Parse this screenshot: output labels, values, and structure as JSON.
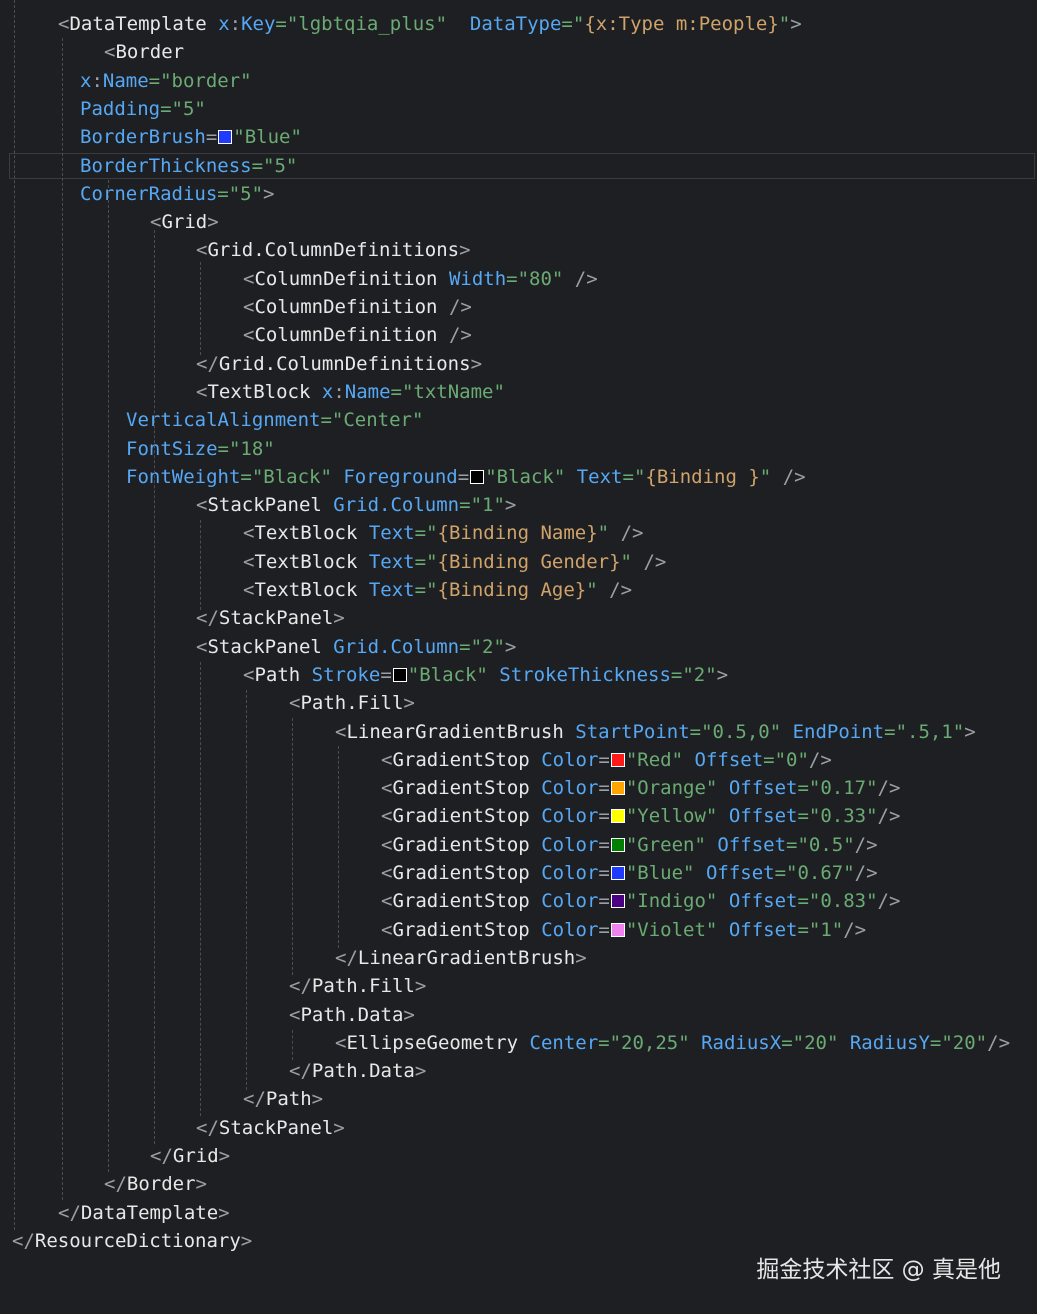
{
  "editor": {
    "lines": [
      {
        "indent": 58,
        "tokens": [
          [
            "b",
            "<"
          ],
          [
            "e",
            "DataTemplate"
          ],
          [
            "s",
            " "
          ],
          [
            "a",
            "x"
          ],
          [
            "b",
            ":"
          ],
          [
            "a",
            "Key"
          ],
          [
            "q",
            "=\"lgbtqia_plus\""
          ],
          [
            "s",
            "  "
          ],
          [
            "a",
            "DataType"
          ],
          [
            "q",
            "=\""
          ],
          [
            "x",
            "{x:Type m:People}"
          ],
          [
            "q",
            "\""
          ],
          [
            "b",
            ">"
          ]
        ]
      },
      {
        "indent": 104,
        "tokens": [
          [
            "b",
            "<"
          ],
          [
            "e",
            "Border"
          ]
        ]
      },
      {
        "indent": 80,
        "tokens": [
          [
            "a",
            "x"
          ],
          [
            "b",
            ":"
          ],
          [
            "a",
            "Name"
          ],
          [
            "q",
            "=\"border\""
          ]
        ]
      },
      {
        "indent": 80,
        "tokens": [
          [
            "a",
            "Padding"
          ],
          [
            "q",
            "=\"5\""
          ]
        ]
      },
      {
        "indent": 80,
        "tokens": [
          [
            "a",
            "BorderBrush"
          ],
          [
            "b",
            "="
          ],
          [
            "sw",
            "#1f3bff"
          ],
          [
            "q",
            "\"Blue\""
          ]
        ]
      },
      {
        "indent": 80,
        "tokens": [
          [
            "a",
            "BorderThickness"
          ],
          [
            "q",
            "=\"5\""
          ]
        ],
        "current": true
      },
      {
        "indent": 80,
        "tokens": [
          [
            "a",
            "CornerRadius"
          ],
          [
            "q",
            "=\"5\""
          ],
          [
            "b",
            ">"
          ]
        ]
      },
      {
        "indent": 150,
        "tokens": [
          [
            "b",
            "<"
          ],
          [
            "e",
            "Grid"
          ],
          [
            "b",
            ">"
          ]
        ]
      },
      {
        "indent": 196,
        "tokens": [
          [
            "b",
            "<"
          ],
          [
            "e",
            "Grid.ColumnDefinitions"
          ],
          [
            "b",
            ">"
          ]
        ]
      },
      {
        "indent": 243,
        "tokens": [
          [
            "b",
            "<"
          ],
          [
            "e",
            "ColumnDefinition"
          ],
          [
            "s",
            " "
          ],
          [
            "a",
            "Width"
          ],
          [
            "q",
            "=\"80\""
          ],
          [
            "s",
            " "
          ],
          [
            "b",
            "/>"
          ]
        ]
      },
      {
        "indent": 243,
        "tokens": [
          [
            "b",
            "<"
          ],
          [
            "e",
            "ColumnDefinition"
          ],
          [
            "s",
            " "
          ],
          [
            "b",
            "/>"
          ]
        ]
      },
      {
        "indent": 243,
        "tokens": [
          [
            "b",
            "<"
          ],
          [
            "e",
            "ColumnDefinition"
          ],
          [
            "s",
            " "
          ],
          [
            "b",
            "/>"
          ]
        ]
      },
      {
        "indent": 196,
        "tokens": [
          [
            "b",
            "</"
          ],
          [
            "e",
            "Grid.ColumnDefinitions"
          ],
          [
            "b",
            ">"
          ]
        ]
      },
      {
        "indent": 196,
        "tokens": [
          [
            "b",
            "<"
          ],
          [
            "e",
            "TextBlock"
          ],
          [
            "s",
            " "
          ],
          [
            "a",
            "x"
          ],
          [
            "b",
            ":"
          ],
          [
            "a",
            "Name"
          ],
          [
            "q",
            "=\"txtName\""
          ]
        ]
      },
      {
        "indent": 126,
        "tokens": [
          [
            "a",
            "VerticalAlignment"
          ],
          [
            "q",
            "=\"Center\""
          ]
        ]
      },
      {
        "indent": 126,
        "tokens": [
          [
            "a",
            "FontSize"
          ],
          [
            "q",
            "=\"18\""
          ]
        ]
      },
      {
        "indent": 126,
        "tokens": [
          [
            "a",
            "FontWeight"
          ],
          [
            "q",
            "=\"Black\""
          ],
          [
            "s",
            " "
          ],
          [
            "a",
            "Foreground"
          ],
          [
            "b",
            "="
          ],
          [
            "sw",
            "#000000"
          ],
          [
            "q",
            "\"Black\""
          ],
          [
            "s",
            " "
          ],
          [
            "a",
            "Text"
          ],
          [
            "q",
            "=\""
          ],
          [
            "x",
            "{Binding }"
          ],
          [
            "q",
            "\""
          ],
          [
            "s",
            " "
          ],
          [
            "b",
            "/>"
          ]
        ]
      },
      {
        "indent": 196,
        "tokens": [
          [
            "b",
            "<"
          ],
          [
            "e",
            "StackPanel"
          ],
          [
            "s",
            " "
          ],
          [
            "a",
            "Grid.Column"
          ],
          [
            "q",
            "=\"1\""
          ],
          [
            "b",
            ">"
          ]
        ]
      },
      {
        "indent": 243,
        "tokens": [
          [
            "b",
            "<"
          ],
          [
            "e",
            "TextBlock"
          ],
          [
            "s",
            " "
          ],
          [
            "a",
            "Text"
          ],
          [
            "q",
            "=\""
          ],
          [
            "x",
            "{Binding Name}"
          ],
          [
            "q",
            "\""
          ],
          [
            "s",
            " "
          ],
          [
            "b",
            "/>"
          ]
        ]
      },
      {
        "indent": 243,
        "tokens": [
          [
            "b",
            "<"
          ],
          [
            "e",
            "TextBlock"
          ],
          [
            "s",
            " "
          ],
          [
            "a",
            "Text"
          ],
          [
            "q",
            "=\""
          ],
          [
            "x",
            "{Binding Gender}"
          ],
          [
            "q",
            "\""
          ],
          [
            "s",
            " "
          ],
          [
            "b",
            "/>"
          ]
        ]
      },
      {
        "indent": 243,
        "tokens": [
          [
            "b",
            "<"
          ],
          [
            "e",
            "TextBlock"
          ],
          [
            "s",
            " "
          ],
          [
            "a",
            "Text"
          ],
          [
            "q",
            "=\""
          ],
          [
            "x",
            "{Binding Age}"
          ],
          [
            "q",
            "\""
          ],
          [
            "s",
            " "
          ],
          [
            "b",
            "/>"
          ]
        ]
      },
      {
        "indent": 196,
        "tokens": [
          [
            "b",
            "</"
          ],
          [
            "e",
            "StackPanel"
          ],
          [
            "b",
            ">"
          ]
        ]
      },
      {
        "indent": 196,
        "tokens": [
          [
            "b",
            "<"
          ],
          [
            "e",
            "StackPanel"
          ],
          [
            "s",
            " "
          ],
          [
            "a",
            "Grid.Column"
          ],
          [
            "q",
            "=\"2\""
          ],
          [
            "b",
            ">"
          ]
        ]
      },
      {
        "indent": 243,
        "tokens": [
          [
            "b",
            "<"
          ],
          [
            "e",
            "Path"
          ],
          [
            "s",
            " "
          ],
          [
            "a",
            "Stroke"
          ],
          [
            "b",
            "="
          ],
          [
            "sw",
            "#000000"
          ],
          [
            "q",
            "\"Black\""
          ],
          [
            "s",
            " "
          ],
          [
            "a",
            "StrokeThickness"
          ],
          [
            "q",
            "=\"2\""
          ],
          [
            "b",
            ">"
          ]
        ]
      },
      {
        "indent": 289,
        "tokens": [
          [
            "b",
            "<"
          ],
          [
            "e",
            "Path.Fill"
          ],
          [
            "b",
            ">"
          ]
        ]
      },
      {
        "indent": 335,
        "tokens": [
          [
            "b",
            "<"
          ],
          [
            "e",
            "LinearGradientBrush"
          ],
          [
            "s",
            " "
          ],
          [
            "a",
            "StartPoint"
          ],
          [
            "q",
            "=\"0.5,0\""
          ],
          [
            "s",
            " "
          ],
          [
            "a",
            "EndPoint"
          ],
          [
            "q",
            "=\".5,1\""
          ],
          [
            "b",
            ">"
          ]
        ]
      },
      {
        "indent": 381,
        "tokens": [
          [
            "b",
            "<"
          ],
          [
            "e",
            "GradientStop"
          ],
          [
            "s",
            " "
          ],
          [
            "a",
            "Color"
          ],
          [
            "b",
            "="
          ],
          [
            "sw",
            "#ff1a1a"
          ],
          [
            "q",
            "\"Red\""
          ],
          [
            "s",
            " "
          ],
          [
            "a",
            "Offset"
          ],
          [
            "q",
            "=\"0\""
          ],
          [
            "b",
            "/>"
          ]
        ]
      },
      {
        "indent": 381,
        "tokens": [
          [
            "b",
            "<"
          ],
          [
            "e",
            "GradientStop"
          ],
          [
            "s",
            " "
          ],
          [
            "a",
            "Color"
          ],
          [
            "b",
            "="
          ],
          [
            "sw",
            "#ffa500"
          ],
          [
            "q",
            "\"Orange\""
          ],
          [
            "s",
            " "
          ],
          [
            "a",
            "Offset"
          ],
          [
            "q",
            "=\"0.17\""
          ],
          [
            "b",
            "/>"
          ]
        ]
      },
      {
        "indent": 381,
        "tokens": [
          [
            "b",
            "<"
          ],
          [
            "e",
            "GradientStop"
          ],
          [
            "s",
            " "
          ],
          [
            "a",
            "Color"
          ],
          [
            "b",
            "="
          ],
          [
            "sw",
            "#ffff00"
          ],
          [
            "q",
            "\"Yellow\""
          ],
          [
            "s",
            " "
          ],
          [
            "a",
            "Offset"
          ],
          [
            "q",
            "=\"0.33\""
          ],
          [
            "b",
            "/>"
          ]
        ]
      },
      {
        "indent": 381,
        "tokens": [
          [
            "b",
            "<"
          ],
          [
            "e",
            "GradientStop"
          ],
          [
            "s",
            " "
          ],
          [
            "a",
            "Color"
          ],
          [
            "b",
            "="
          ],
          [
            "sw",
            "#008000"
          ],
          [
            "q",
            "\"Green\""
          ],
          [
            "s",
            " "
          ],
          [
            "a",
            "Offset"
          ],
          [
            "q",
            "=\"0.5\""
          ],
          [
            "b",
            "/>"
          ]
        ]
      },
      {
        "indent": 381,
        "tokens": [
          [
            "b",
            "<"
          ],
          [
            "e",
            "GradientStop"
          ],
          [
            "s",
            " "
          ],
          [
            "a",
            "Color"
          ],
          [
            "b",
            "="
          ],
          [
            "sw",
            "#1f3bff"
          ],
          [
            "q",
            "\"Blue\""
          ],
          [
            "s",
            " "
          ],
          [
            "a",
            "Offset"
          ],
          [
            "q",
            "=\"0.67\""
          ],
          [
            "b",
            "/>"
          ]
        ]
      },
      {
        "indent": 381,
        "tokens": [
          [
            "b",
            "<"
          ],
          [
            "e",
            "GradientStop"
          ],
          [
            "s",
            " "
          ],
          [
            "a",
            "Color"
          ],
          [
            "b",
            "="
          ],
          [
            "sw",
            "#4b0082"
          ],
          [
            "q",
            "\"Indigo\""
          ],
          [
            "s",
            " "
          ],
          [
            "a",
            "Offset"
          ],
          [
            "q",
            "=\"0.83\""
          ],
          [
            "b",
            "/>"
          ]
        ]
      },
      {
        "indent": 381,
        "tokens": [
          [
            "b",
            "<"
          ],
          [
            "e",
            "GradientStop"
          ],
          [
            "s",
            " "
          ],
          [
            "a",
            "Color"
          ],
          [
            "b",
            "="
          ],
          [
            "sw",
            "#ee82ee"
          ],
          [
            "q",
            "\"Violet\""
          ],
          [
            "s",
            " "
          ],
          [
            "a",
            "Offset"
          ],
          [
            "q",
            "=\"1\""
          ],
          [
            "b",
            "/>"
          ]
        ]
      },
      {
        "indent": 335,
        "tokens": [
          [
            "b",
            "</"
          ],
          [
            "e",
            "LinearGradientBrush"
          ],
          [
            "b",
            ">"
          ]
        ]
      },
      {
        "indent": 289,
        "tokens": [
          [
            "b",
            "</"
          ],
          [
            "e",
            "Path.Fill"
          ],
          [
            "b",
            ">"
          ]
        ]
      },
      {
        "indent": 289,
        "tokens": [
          [
            "b",
            "<"
          ],
          [
            "e",
            "Path.Data"
          ],
          [
            "b",
            ">"
          ]
        ]
      },
      {
        "indent": 335,
        "tokens": [
          [
            "b",
            "<"
          ],
          [
            "e",
            "EllipseGeometry"
          ],
          [
            "s",
            " "
          ],
          [
            "a",
            "Center"
          ],
          [
            "q",
            "=\"20,25\""
          ],
          [
            "s",
            " "
          ],
          [
            "a",
            "RadiusX"
          ],
          [
            "q",
            "=\"20\""
          ],
          [
            "s",
            " "
          ],
          [
            "a",
            "RadiusY"
          ],
          [
            "q",
            "=\"20\""
          ],
          [
            "b",
            "/>"
          ]
        ]
      },
      {
        "indent": 289,
        "tokens": [
          [
            "b",
            "</"
          ],
          [
            "e",
            "Path.Data"
          ],
          [
            "b",
            ">"
          ]
        ]
      },
      {
        "indent": 243,
        "tokens": [
          [
            "b",
            "</"
          ],
          [
            "e",
            "Path"
          ],
          [
            "b",
            ">"
          ]
        ]
      },
      {
        "indent": 196,
        "tokens": [
          [
            "b",
            "</"
          ],
          [
            "e",
            "StackPanel"
          ],
          [
            "b",
            ">"
          ]
        ]
      },
      {
        "indent": 150,
        "tokens": [
          [
            "b",
            "</"
          ],
          [
            "e",
            "Grid"
          ],
          [
            "b",
            ">"
          ]
        ]
      },
      {
        "indent": 104,
        "tokens": [
          [
            "b",
            "</"
          ],
          [
            "e",
            "Border"
          ],
          [
            "b",
            ">"
          ]
        ]
      },
      {
        "indent": 58,
        "tokens": [
          [
            "b",
            "</"
          ],
          [
            "e",
            "DataTemplate"
          ],
          [
            "b",
            ">"
          ]
        ]
      },
      {
        "indent": 12,
        "tokens": [
          [
            "b",
            "</"
          ],
          [
            "e",
            "ResourceDictionary"
          ],
          [
            "b",
            ">"
          ]
        ]
      }
    ]
  },
  "watermark": {
    "text": "掘金技术社区 @ 真是他"
  }
}
